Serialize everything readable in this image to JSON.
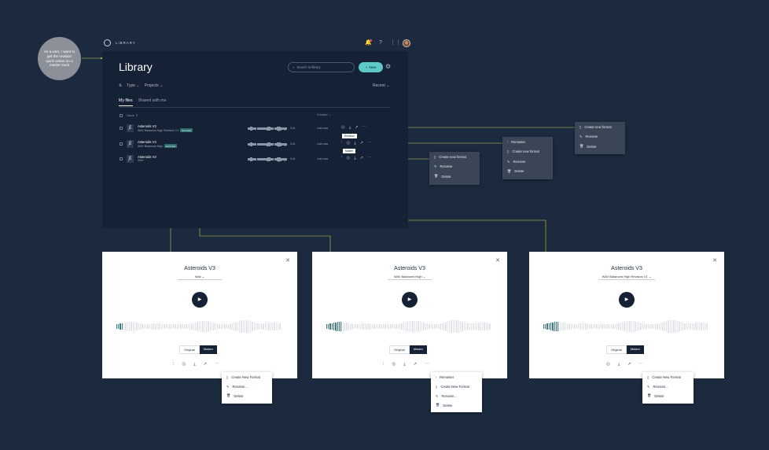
{
  "persona": {
    "text": "As a user, I want to get the revision quick action on a master track"
  },
  "app": {
    "brand": "LIBRARY",
    "title": "Library"
  },
  "header": {
    "bell_icon": "bell-icon",
    "help_icon": "help-icon",
    "apps_icon": "grid-icon"
  },
  "search": {
    "placeholder": "Search in library"
  },
  "toolbar": {
    "new_label": "New",
    "recent_label": "Recent"
  },
  "filters": {
    "type_label": "Type",
    "projects_label": "Projects"
  },
  "tabs": [
    {
      "label": "My files"
    },
    {
      "label": "Shared with me"
    }
  ],
  "table": {
    "headers": {
      "name": "Name",
      "created": "Created"
    },
    "rows": [
      {
        "name": "Asteroids V3",
        "format": "WAV Balanced High Revision V1",
        "badge": "MASTER",
        "duration": "3:41",
        "created": "Just now"
      },
      {
        "name": "Asteroids V3",
        "format": "WAV Balanced High",
        "badge": "MASTER",
        "duration": "3:41",
        "created": "Just now"
      },
      {
        "name": "Asteroids V3",
        "format": "WAV",
        "badge": "",
        "duration": "3:41",
        "created": "Just now"
      }
    ],
    "tooltips": {
      "revision": "Revision",
      "master": "Master"
    }
  },
  "dark_menus": {
    "menu_a": [
      "Create new format",
      "Rename",
      "Delete"
    ],
    "menu_b": [
      "Remaster",
      "Create new format",
      "Rename",
      "Delete"
    ],
    "menu_c": [
      "Create new format",
      "Rename",
      "Delete"
    ]
  },
  "modals": [
    {
      "title": "Asteroids V3",
      "format": "Wav",
      "seg_original": "Original",
      "seg_master": "Master",
      "progress": 0.04,
      "menu": [
        "Create New Format",
        "Rename...",
        "Delete"
      ]
    },
    {
      "title": "Asteroids V3",
      "format": "WAV Balanced High",
      "seg_original": "Original",
      "seg_master": "Master",
      "progress": 0.09,
      "menu": [
        "Remaster",
        "Create New Format",
        "Rename...",
        "Delete"
      ]
    },
    {
      "title": "Asteroids V3",
      "format": "WAV Balanced High Revision V1",
      "seg_original": "Original",
      "seg_master": "Master",
      "progress": 0.09,
      "menu": [
        "Create New Format",
        "Rename...",
        "Delete"
      ]
    }
  ],
  "colors": {
    "background": "#1b2a3e",
    "panel": "#152235",
    "accent": "#5dc9c8",
    "connector": "#d8c848"
  }
}
